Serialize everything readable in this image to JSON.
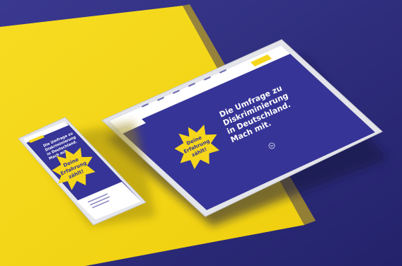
{
  "scene": {
    "colors": {
      "background_navy": "#2f2e7d",
      "yellow_block": "#f2d513",
      "device_frame": "#e9eaee",
      "screen_navy": "#363496",
      "badge_yellow": "#f6d61b",
      "text_white": "#ffffff"
    }
  },
  "tablet": {
    "headline_lines": [
      "Die Umfrage zu",
      "Diskriminierung",
      "in Deutschland.",
      "Mach mit."
    ],
    "badge_lines": [
      "Deine",
      "Erfahrung",
      "zählt!"
    ],
    "scroll_icon": "chevron-down-icon",
    "menu_icon": "hamburger-icon"
  },
  "phone": {
    "headline_lines": [
      "Die Umfrage zu",
      "Diskriminierung",
      "in Deutschland.",
      "Mach mit."
    ],
    "badge_lines": [
      "Deine",
      "Erfahrung",
      "zählt!"
    ],
    "menu_icon": "hamburger-icon"
  }
}
